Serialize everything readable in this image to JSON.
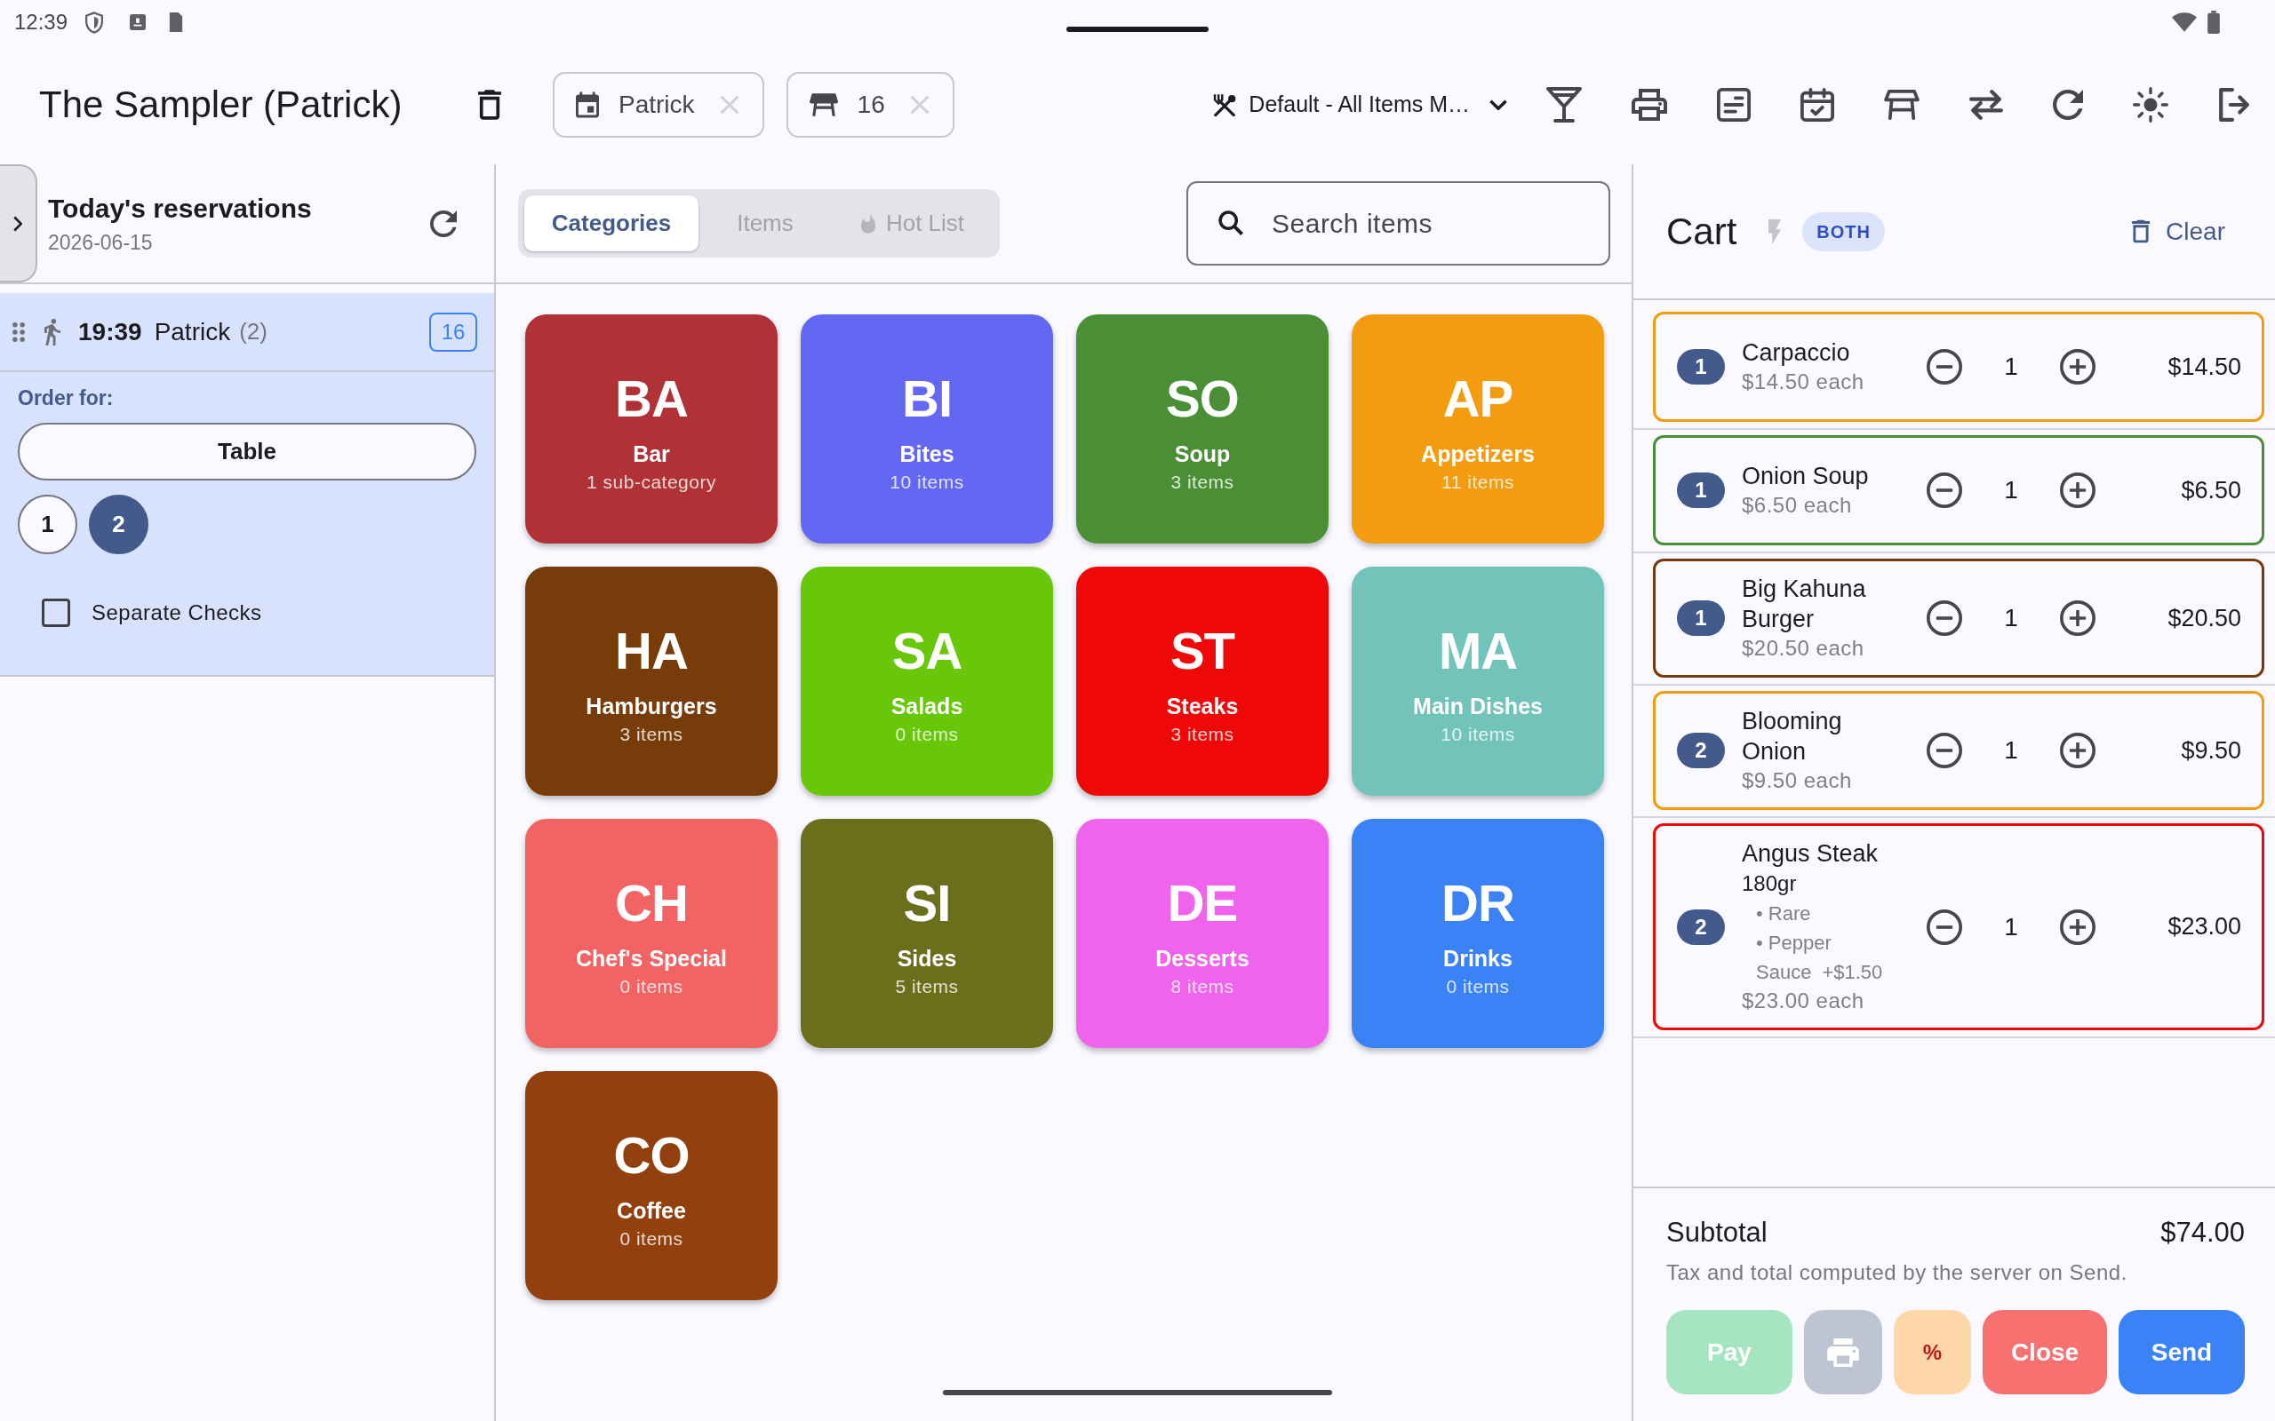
{
  "status_bar": {
    "time": "12:39"
  },
  "app_bar": {
    "title": "The Sampler (Patrick)",
    "chips": [
      {
        "kind": "reservation",
        "label": "Patrick"
      },
      {
        "kind": "table",
        "label": "16"
      }
    ],
    "menu": {
      "label": "Default - All Items M…"
    }
  },
  "reservations": {
    "title": "Today's reservations",
    "date": "2026-06-15",
    "items": [
      {
        "time": "19:39",
        "guest": "Patrick",
        "party": "(2)",
        "table": "16",
        "selected": true,
        "order_for": {
          "label": "Order for:",
          "table_button": "Table",
          "seats": [
            {
              "label": "1",
              "selected": false
            },
            {
              "label": "2",
              "selected": true
            }
          ],
          "separate_checks": {
            "label": "Separate Checks",
            "checked": false
          }
        }
      }
    ]
  },
  "view_tabs": [
    {
      "label": "Categories",
      "kind": "plain",
      "selected": true
    },
    {
      "label": "Items",
      "kind": "plain",
      "selected": false
    },
    {
      "label": "Hot List",
      "kind": "hot",
      "selected": false
    }
  ],
  "search": {
    "placeholder": "Search items"
  },
  "categories": [
    {
      "abbr": "BA",
      "name": "Bar",
      "count": "1 sub-category",
      "color": "#b03236"
    },
    {
      "abbr": "BI",
      "name": "Bites",
      "count": "10 items",
      "color": "#6467f2"
    },
    {
      "abbr": "SO",
      "name": "Soup",
      "count": "3 items",
      "color": "#4a8f35"
    },
    {
      "abbr": "AP",
      "name": "Appetizers",
      "count": "11 items",
      "color": "#f39c0f"
    },
    {
      "abbr": "HA",
      "name": "Hamburgers",
      "count": "3 items",
      "color": "#773c09"
    },
    {
      "abbr": "SA",
      "name": "Salads",
      "count": "0 items",
      "color": "#67c708"
    },
    {
      "abbr": "ST",
      "name": "Steaks",
      "count": "3 items",
      "color": "#ee0808"
    },
    {
      "abbr": "MA",
      "name": "Main Dishes",
      "count": "10 items",
      "color": "#72c4bb"
    },
    {
      "abbr": "CH",
      "name": "Chef's Special",
      "count": "0 items",
      "color": "#f26464"
    },
    {
      "abbr": "SI",
      "name": "Sides",
      "count": "5 items",
      "color": "#6b6e1a"
    },
    {
      "abbr": "DE",
      "name": "Desserts",
      "count": "8 items",
      "color": "#f063ec"
    },
    {
      "abbr": "DR",
      "name": "Drinks",
      "count": "0 items",
      "color": "#3b82f6"
    },
    {
      "abbr": "CO",
      "name": "Coffee",
      "count": "0 items",
      "color": "#92400e"
    }
  ],
  "cart": {
    "title": "Cart",
    "mode": "BOTH",
    "clear": "Clear",
    "items": [
      {
        "seat": "1",
        "name": "Carpaccio",
        "unit_price": "$14.50 each",
        "quantity": "1",
        "total": "$14.50",
        "color": "#f39c0f"
      },
      {
        "seat": "1",
        "name": "Onion Soup",
        "unit_price": "$6.50 each",
        "quantity": "1",
        "total": "$6.50",
        "color": "#4a8f35"
      },
      {
        "seat": "1",
        "name": "Big Kahuna Burger",
        "unit_price": "$20.50 each",
        "quantity": "1",
        "total": "$20.50",
        "color": "#773c09"
      },
      {
        "seat": "2",
        "name": "Blooming Onion",
        "unit_price": "$9.50 each",
        "quantity": "1",
        "total": "$9.50",
        "color": "#f39c0f"
      },
      {
        "seat": "2",
        "name": "Angus Steak",
        "variant": "180gr",
        "modifiers": [
          {
            "text": "• Rare"
          },
          {
            "text": "• Pepper Sauce",
            "price": "+$1.50"
          }
        ],
        "unit_price": "$23.00 each",
        "quantity": "1",
        "total": "$23.00",
        "color": "#ee0808"
      }
    ],
    "subtotal_label": "Subtotal",
    "subtotal": "$74.00",
    "note": "Tax and total computed by the server on Send.",
    "actions": [
      {
        "kind": "pay",
        "label": "Pay",
        "disabled": true
      },
      {
        "kind": "print",
        "disabled": true
      },
      {
        "kind": "discount",
        "label": "%",
        "disabled": false
      },
      {
        "kind": "close",
        "label": "Close",
        "disabled": false
      },
      {
        "kind": "send",
        "label": "Send",
        "disabled": false
      }
    ]
  }
}
